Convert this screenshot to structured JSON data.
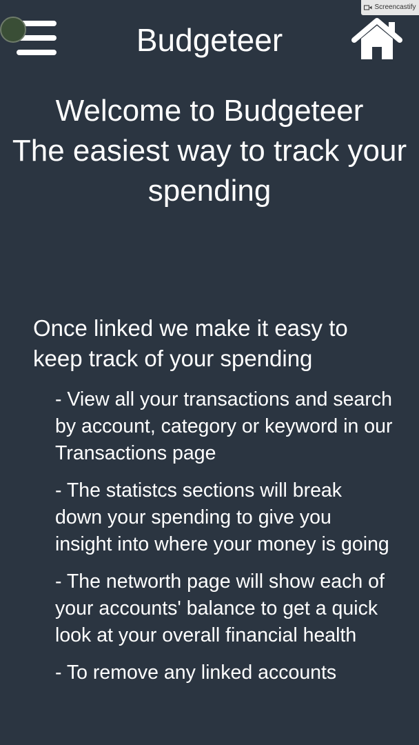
{
  "header": {
    "title": "Budgeteer",
    "menu_icon": "hamburger-menu-icon",
    "home_icon": "home-icon"
  },
  "recorder_badge": {
    "label": "Screencastify"
  },
  "welcome": {
    "line1": "Welcome to Budgeteer",
    "line2": "The easiest way to track your spending"
  },
  "intro": "Once linked we make it easy to keep track of your spending",
  "features": [
    "- View all your transactions and search by account, category or keyword in our Transactions page",
    "- The statistcs sections will break down your spending to give you insight into where your money is going",
    "- The networth page will show each of your accounts' balance to get a quick look at your overall financial health",
    "- To remove any linked accounts"
  ],
  "colors": {
    "background": "#2b3541",
    "text": "#ffffff"
  }
}
